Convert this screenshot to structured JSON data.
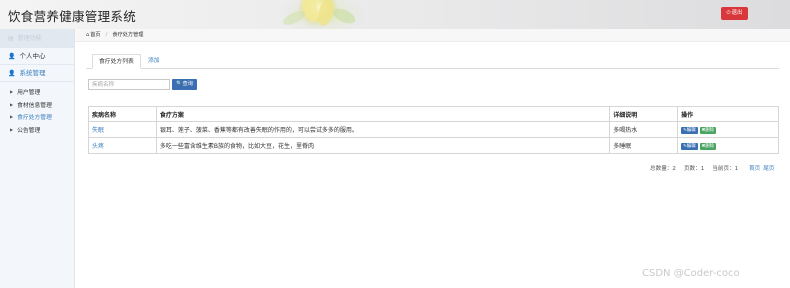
{
  "header": {
    "title": "饮食营养健康管理系统",
    "logout_label": "退出",
    "logout_icon": "power-icon"
  },
  "sidebar": {
    "top_label": "管理功能",
    "sections": [
      {
        "label": "个人中心",
        "icon": "user-icon"
      },
      {
        "label": "系统管理",
        "icon": "user-icon"
      }
    ],
    "items": [
      {
        "label": "用户管理"
      },
      {
        "label": "食材信息管理"
      },
      {
        "label": "食疗处方管理",
        "active": true
      },
      {
        "label": "公告管理"
      }
    ]
  },
  "breadcrumb": {
    "home": "首页",
    "current": "食疗处方管理"
  },
  "tabs": [
    {
      "label": "食疗处方列表",
      "active": true
    },
    {
      "label": "添加"
    }
  ],
  "search": {
    "placeholder": "疾病名称",
    "button_label": "查询"
  },
  "table": {
    "headers": [
      "疾病名称",
      "食疗方案",
      "详细说明",
      "操作"
    ],
    "rows": [
      {
        "name": "失眠",
        "plan": "银耳、莲子、菠菜、香蕉等都有改善失眠的作用的，可以尝试多多的服用。",
        "detail": "多喝热水",
        "edit": "编辑",
        "delete": "删除"
      },
      {
        "name": "头疼",
        "plan": "多吃一些富含维生素B族的食物，比如大豆，花生，里脊肉",
        "detail": "多睡眠",
        "edit": "编辑",
        "delete": "删除"
      }
    ]
  },
  "pagination": {
    "total": "总数量：2",
    "pages": "页数：1",
    "current": "当前页：1",
    "first": "首页",
    "last": "尾页"
  },
  "watermark": "CSDN @Coder-coco",
  "colors": {
    "accent": "#3a7fc0",
    "logout": "#d9373a",
    "delete": "#4aa564",
    "primary_button": "#3a70b3"
  }
}
